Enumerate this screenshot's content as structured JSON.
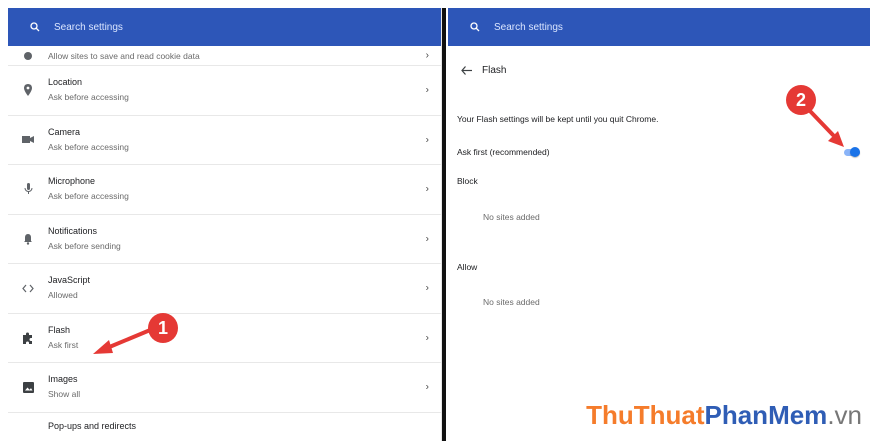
{
  "left": {
    "search_placeholder": "Search settings",
    "items": [
      {
        "title": "",
        "sub": "Allow sites to save and read cookie data"
      },
      {
        "title": "Location",
        "sub": "Ask before accessing"
      },
      {
        "title": "Camera",
        "sub": "Ask before accessing"
      },
      {
        "title": "Microphone",
        "sub": "Ask before accessing"
      },
      {
        "title": "Notifications",
        "sub": "Ask before sending"
      },
      {
        "title": "JavaScript",
        "sub": "Allowed"
      },
      {
        "title": "Flash",
        "sub": "Ask first"
      },
      {
        "title": "Images",
        "sub": "Show all"
      },
      {
        "title": "Pop-ups and redirects",
        "sub": ""
      }
    ]
  },
  "right": {
    "search_placeholder": "Search settings",
    "page_title": "Flash",
    "note": "Your Flash settings will be kept until you quit Chrome.",
    "ask_label": "Ask first (recommended)",
    "toggle_on": true,
    "block_label": "Block",
    "block_empty": "No sites added",
    "allow_label": "Allow",
    "allow_empty": "No sites added"
  },
  "callouts": {
    "one": "1",
    "two": "2"
  },
  "watermark": {
    "part1": "ThuThuat",
    "part2": "PhanMem",
    "part3": ".vn"
  },
  "colors": {
    "topbar": "#2d56b8",
    "toggle": "#1a73e8",
    "callout": "#e53935"
  }
}
